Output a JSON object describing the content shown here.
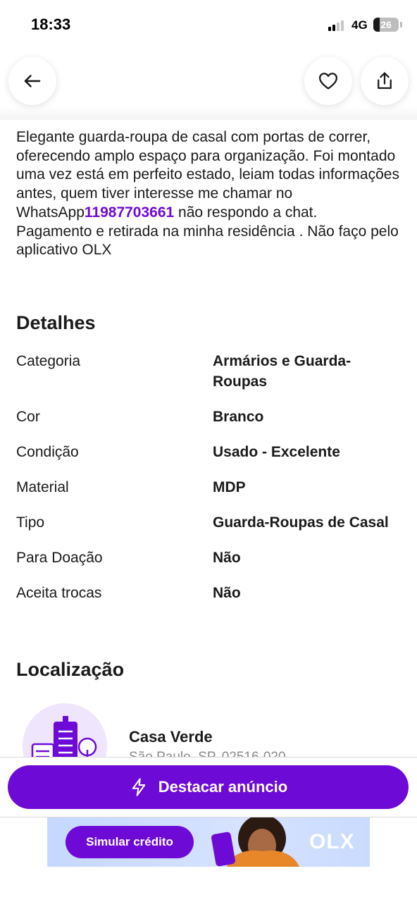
{
  "status_bar": {
    "time": "18:33",
    "network": "4G",
    "battery": "26",
    "battery_level": 0.26
  },
  "top_bar": {
    "back_icon": "arrow-left-icon",
    "favorite_icon": "heart-icon",
    "share_icon": "share-icon"
  },
  "description": {
    "text_before_phone": "Elegante guarda-roupa de casal com portas de correr, oferecendo amplo espaço para organização. Foi montado uma vez está em perfeito estado, leiam todas informações antes, quem tiver interesse me chamar no WhatsApp",
    "phone": "11987703661",
    "text_after_phone": " não respondo a chat.",
    "payment_note": "Pagamento e retirada na minha residência . Não faço pelo aplicativo OLX"
  },
  "details": {
    "title": "Detalhes",
    "rows": [
      {
        "label": "Categoria",
        "value": "Armários e Guarda-Roupas"
      },
      {
        "label": "Cor",
        "value": "Branco"
      },
      {
        "label": "Condição",
        "value": "Usado - Excelente"
      },
      {
        "label": "Material",
        "value": "MDP"
      },
      {
        "label": "Tipo",
        "value": "Guarda-Roupas de Casal"
      },
      {
        "label": "Para Doação",
        "value": "Não"
      },
      {
        "label": "Aceita trocas",
        "value": "Não"
      }
    ]
  },
  "location": {
    "title": "Localização",
    "neighborhood": "Casa Verde",
    "city_line": "São Paulo, SP, 02516-020",
    "icon": "city-buildings-icon"
  },
  "cta": {
    "label": "Destacar anúncio",
    "icon": "lightning-bolt-icon"
  },
  "banner": {
    "button_label": "Simular crédito",
    "logo": "OLX"
  },
  "colors": {
    "brand_purple": "#6e0ad6",
    "banner_bg": "#c9dbff"
  }
}
